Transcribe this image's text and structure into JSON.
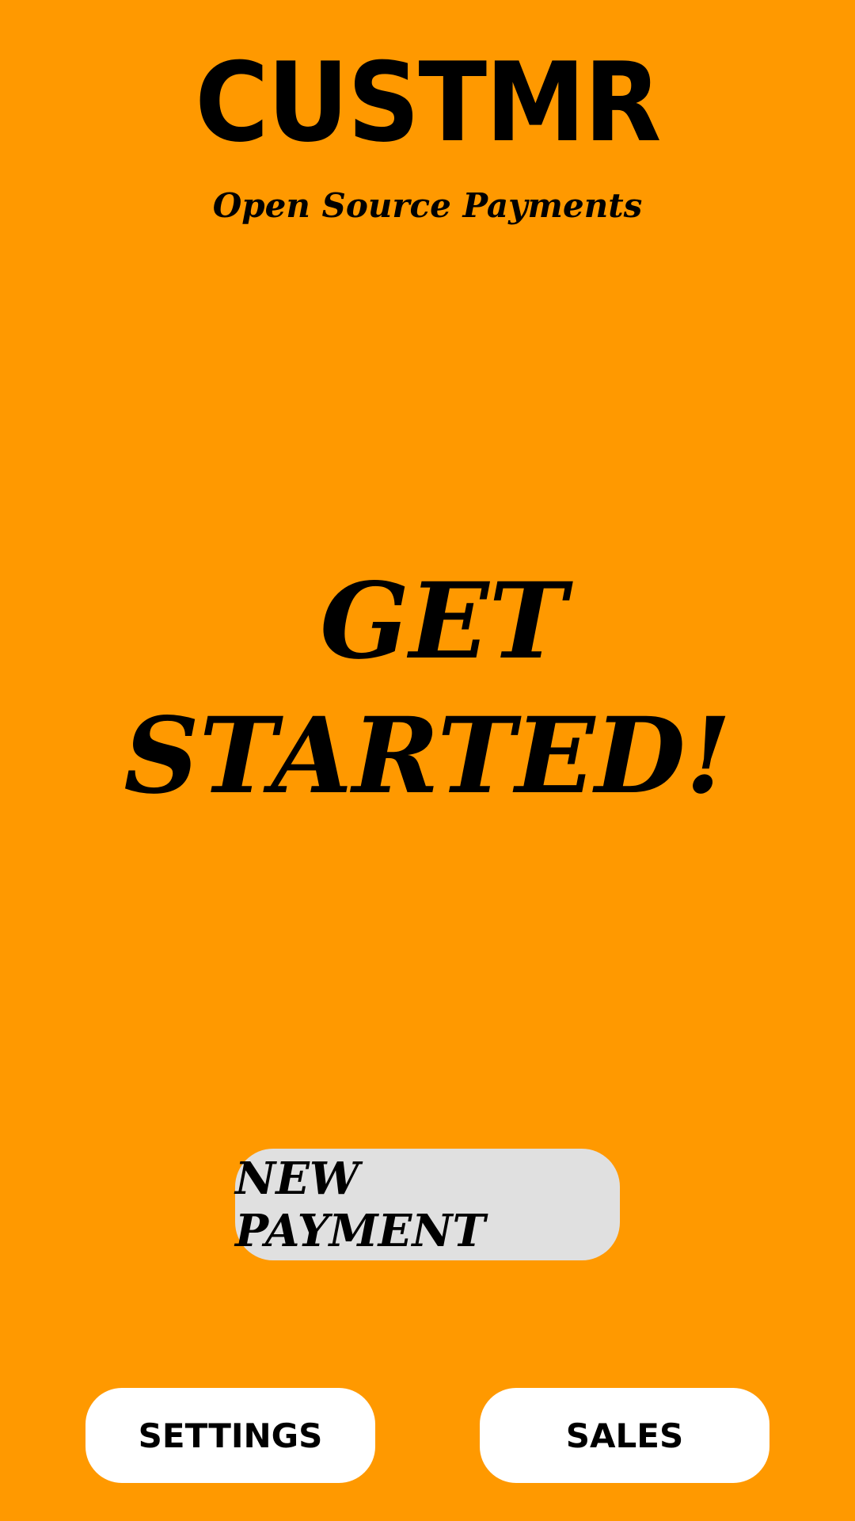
{
  "app": {
    "title": "CUSTMR",
    "subtitle": "Open Source Payments"
  },
  "hero": {
    "line1": "GET",
    "line2": "STARTED!"
  },
  "actions": {
    "new_payment_label": "NEW PAYMENT"
  },
  "nav": {
    "settings_label": "SETTINGS",
    "sales_label": "SALES"
  },
  "colors": {
    "background": "#FF9900",
    "primary_button": "#E0E0E0",
    "secondary_button": "#FFFFFF",
    "text": "#000000"
  }
}
